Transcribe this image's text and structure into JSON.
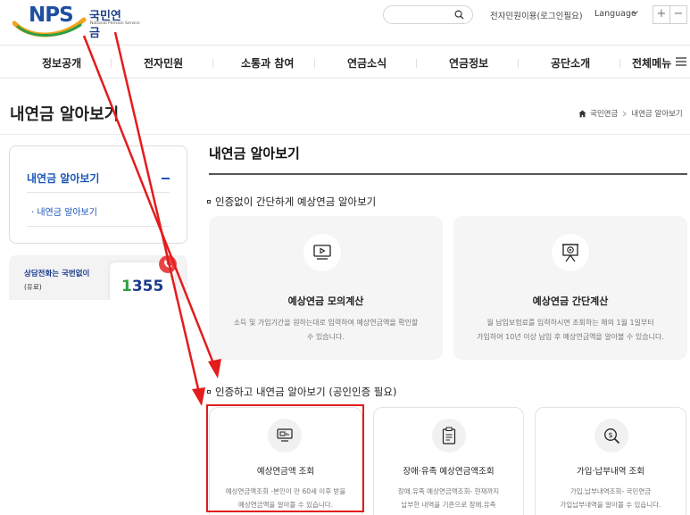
{
  "header": {
    "logo_text": "NPS",
    "logo_korean": "국민연금",
    "logo_english": "National Pension Service",
    "search_placeholder": "",
    "top_link": "전자민원이용(로그인필요)",
    "language": "Language",
    "zoom_in": "+",
    "zoom_out": "−"
  },
  "gnb": {
    "items": [
      "정보공개",
      "전자민원",
      "소통과 참여",
      "연금소식",
      "연금정보",
      "공단소개"
    ],
    "all_menu": "전체메뉴"
  },
  "page": {
    "title": "내연금 알아보기",
    "breadcrumb": [
      "국민연금",
      "내연금 알아보기"
    ]
  },
  "sidebar": {
    "menu_title": "내연금 알아보기",
    "sub_item": "· 내연금 알아보기",
    "phone_label": "상담전화는 국번없이",
    "phone_sub": "(유료)",
    "phone_number_a": "1",
    "phone_number_b": "355"
  },
  "main": {
    "title": "내연금 알아보기",
    "section1": "인증없이 간단하게 예상연금 알아보기",
    "section2": "인증하고 내연금 알아보기 (공인인증 필요)",
    "cards1": [
      {
        "title": "예상연금 모의계산",
        "desc1": "소득 및 가입기간을 원하는대로 입력하여 예상연금액을 확인할",
        "desc2": "수 있습니다."
      },
      {
        "title": "예상연금 간단계산",
        "desc1": "월 납입보험료를 입력하시면 조회하는 해의 1월 1일부터",
        "desc2": "가입하여 10년 이상 납입 후 예상연금액을 알아볼 수 있습니다."
      }
    ],
    "cards2": [
      {
        "title": "예상연금액 조회",
        "desc1": "예상연금액조회 -본인이 만 60세 이후 받을",
        "desc2": "예상연금액을 알아볼 수 있습니다."
      },
      {
        "title": "장애·유족 예상연금액조회",
        "desc1": "장애.유족 예상연금액조회- 현재까지",
        "desc2": "납부한 내역을 기준으로 장애.유족"
      },
      {
        "title": "가입·납부내역 조회",
        "desc1": "가입.납부내역조회- 국민연금",
        "desc2": "가입납부내역을 알아볼 수 있습니다."
      }
    ]
  },
  "colors": {
    "brand_blue": "#1f4fa0",
    "link_blue": "#1a56b8",
    "annotation_red": "#e31c1c",
    "card_gray": "#f5f5f5"
  }
}
